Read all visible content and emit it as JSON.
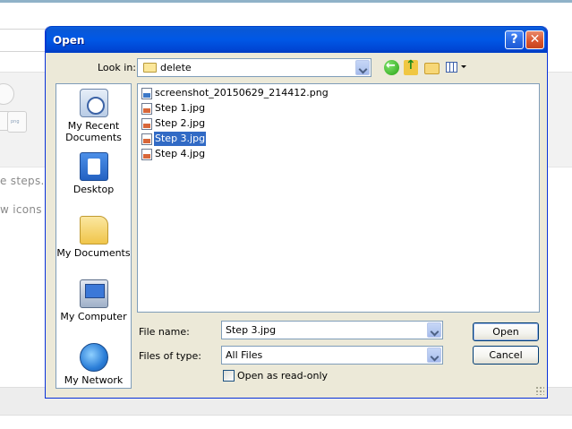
{
  "background": {
    "chip_label": "png",
    "text_line_1": "e steps.",
    "text_line_2": "w icons"
  },
  "dialog": {
    "title": "Open",
    "help_button": "?",
    "close_button": "✕",
    "look_in_label": "Look in:",
    "look_in_value": "delete",
    "toolbar": {
      "back_icon": "back-arrow-icon",
      "up_icon": "up-folder-icon",
      "new_folder_icon": "new-folder-icon",
      "views_icon": "views-menu-icon"
    },
    "places": [
      {
        "label": "My Recent Documents",
        "icon": "recent-documents-icon"
      },
      {
        "label": "Desktop",
        "icon": "desktop-icon"
      },
      {
        "label": "My Documents",
        "icon": "my-documents-icon"
      },
      {
        "label": "My Computer",
        "icon": "my-computer-icon"
      },
      {
        "label": "My Network Places",
        "icon": "network-places-icon"
      }
    ],
    "files": [
      {
        "name": "screenshot_20150629_214412.png",
        "selected": false
      },
      {
        "name": "Step 1.jpg",
        "selected": false
      },
      {
        "name": "Step 2.jpg",
        "selected": false
      },
      {
        "name": "Step 3.jpg",
        "selected": true
      },
      {
        "name": "Step 4.jpg",
        "selected": false
      }
    ],
    "file_name_label": "File name:",
    "file_name_value": "Step 3.jpg",
    "files_of_type_label": "Files of type:",
    "files_of_type_value": "All Files",
    "read_only_label": "Open as read-only",
    "open_button": "Open",
    "cancel_button": "Cancel",
    "selection_color": "#316ac5",
    "title_bar_color": "#0058e6"
  }
}
